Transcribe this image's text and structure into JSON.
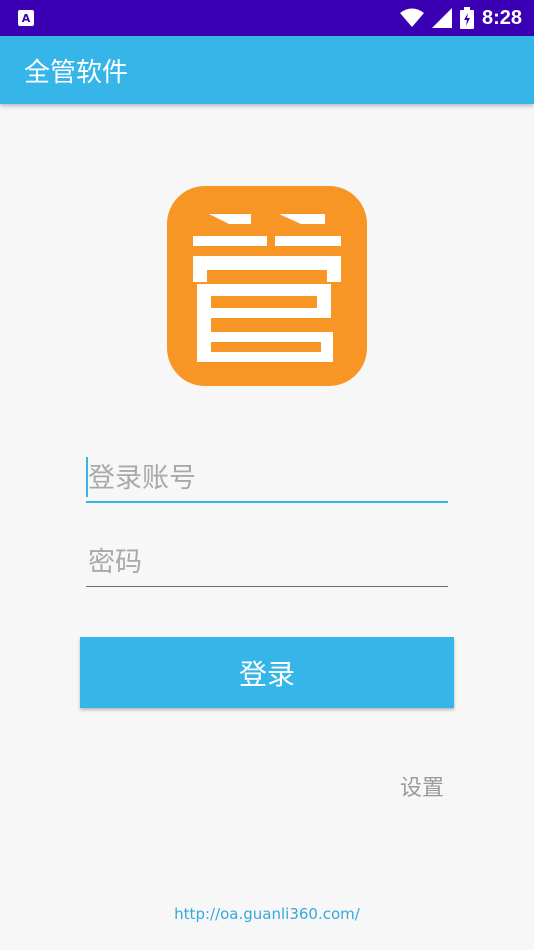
{
  "status_bar": {
    "notification_icon": "app-notification-icon",
    "time": "8:28",
    "icons": [
      "wifi-icon",
      "signal-icon",
      "battery-icon"
    ]
  },
  "app_bar": {
    "title": "全管软件"
  },
  "logo": {
    "char": "管",
    "color": "#f79625"
  },
  "login_form": {
    "account_placeholder": "登录账号",
    "password_placeholder": "密码",
    "login_label": "登录"
  },
  "settings_label": "设置",
  "footer_url": "http://oa.guanli360.com/",
  "colors": {
    "accent": "#36b5e8",
    "status_bar": "#3b00b3",
    "logo": "#f79625"
  }
}
